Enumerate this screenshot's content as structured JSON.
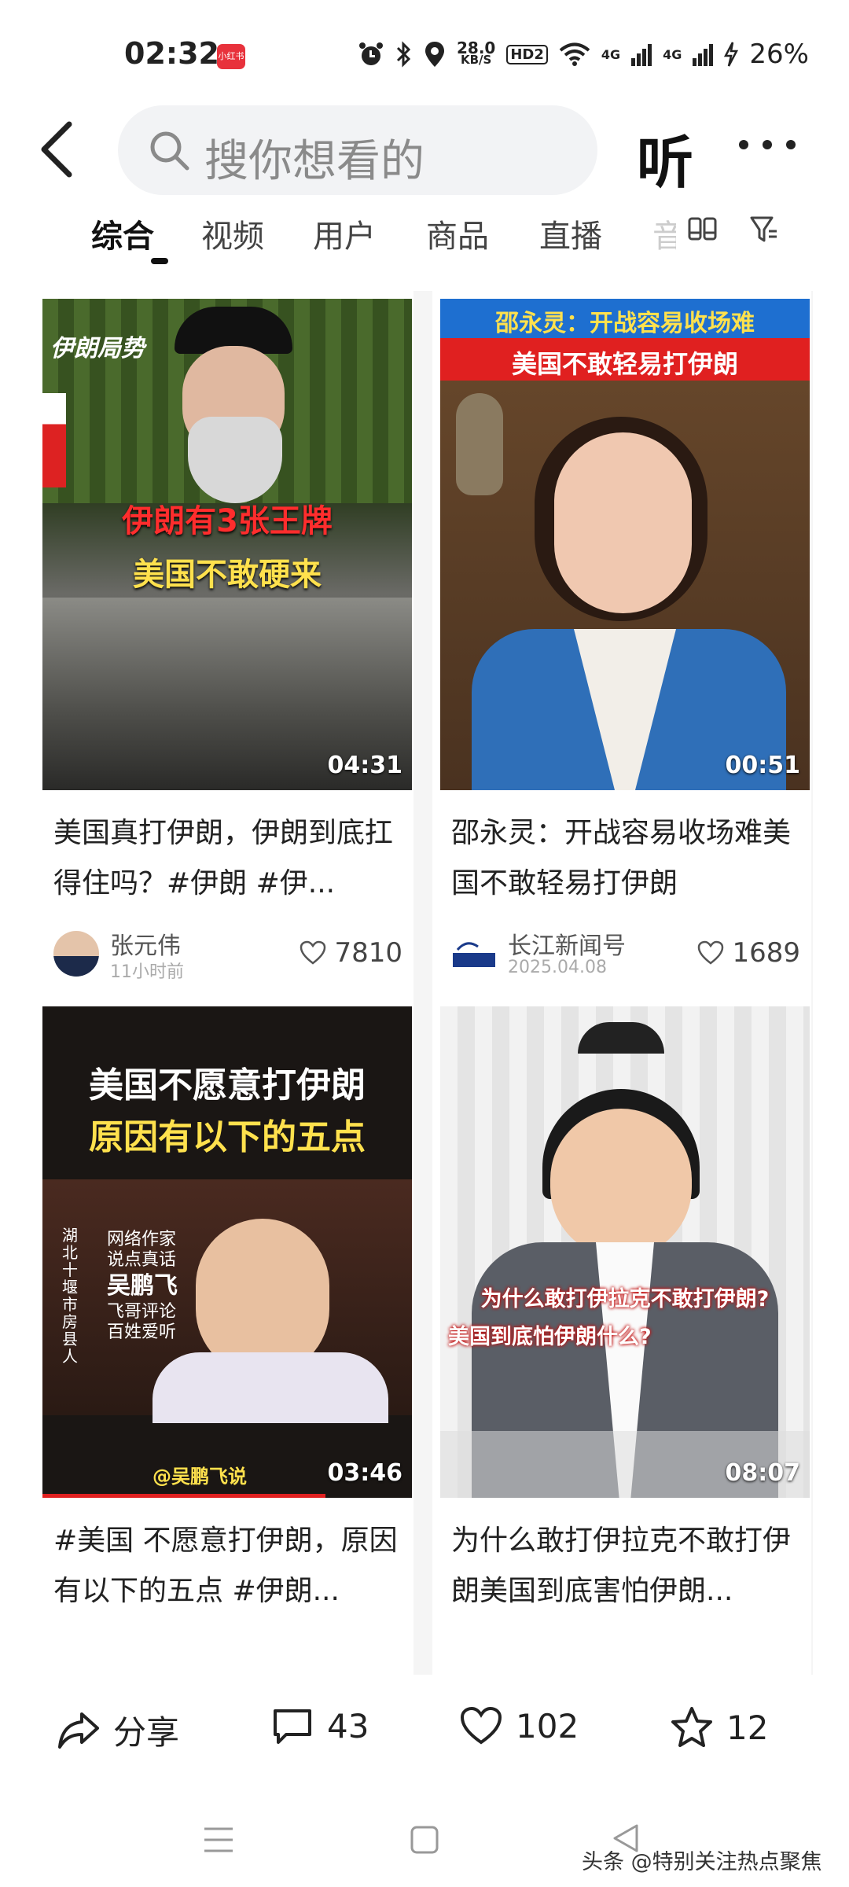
{
  "status_bar": {
    "time": "02:32",
    "app_badge": "小红书",
    "net_speed_top": "28.0",
    "net_speed_unit": "KB/S",
    "hd_label": "HD2",
    "signal1": "4G",
    "signal2": "4G",
    "battery": "26%"
  },
  "header": {
    "search_placeholder": "搜你想看的",
    "listen_label": "听"
  },
  "tabs": [
    {
      "label": "综合",
      "active": true
    },
    {
      "label": "视频"
    },
    {
      "label": "用户"
    },
    {
      "label": "商品"
    },
    {
      "label": "直播"
    },
    {
      "label": "音"
    }
  ],
  "cards": [
    {
      "title": "美国真打伊朗，伊朗到底扛得住吗？#伊朗 #伊...",
      "duration": "04:31",
      "author": "张元伟",
      "time": "11小时前",
      "likes": "7810",
      "overlay_tag": "伊朗局势",
      "overlay_line1": "伊朗有3张王牌",
      "overlay_line2": "美国不敢硬来"
    },
    {
      "title": "邵永灵：开战容易收场难美国不敢轻易打伊朗",
      "duration": "00:51",
      "author": "长江新闻号",
      "time": "2025.04.08",
      "likes": "1689",
      "overlay_line1": "邵永灵：开战容易收场难",
      "overlay_line2": "美国不敢轻易打伊朗"
    },
    {
      "title": "#美国 不愿意打伊朗，原因有以下的五点 #伊朗...",
      "duration": "03:46",
      "overlay_line1": "美国不愿意打伊朗",
      "overlay_line2": "原因有以下的五点",
      "overlay_side1": "网络作家",
      "overlay_side2": "说点真话",
      "overlay_name": "吴鹏飞",
      "overlay_side3": "飞哥评论",
      "overlay_side4": "百姓爱听",
      "overlay_vertical": "湖北十堰市房县人",
      "overlay_handle": "@吴鹏飞说"
    },
    {
      "title": "为什么敢打伊拉克不敢打伊朗美国到底害怕伊朗...",
      "duration": "08:07",
      "overlay_line1": "为什么敢打伊拉克不敢打伊朗?",
      "overlay_line2": "美国到底怕伊朗什么?"
    }
  ],
  "actions": {
    "share": "分享",
    "comments": "43",
    "likes": "102",
    "favorites": "12"
  },
  "watermark": "头条 @特别关注热点聚焦",
  "colors": {
    "accent_red": "#e8323c",
    "overlay_yellow": "#ffe14d"
  }
}
